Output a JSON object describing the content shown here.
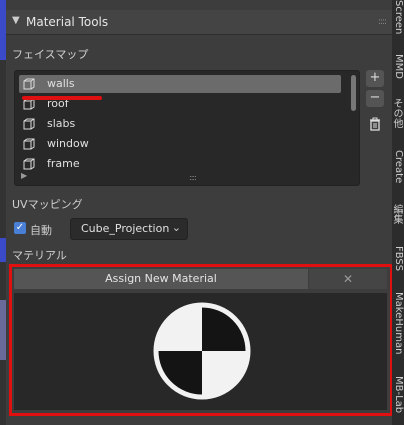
{
  "panel": {
    "title": "Material Tools",
    "face_map_label": "フェイスマップ",
    "face_maps": [
      {
        "name": "walls",
        "selected": true
      },
      {
        "name": "roof",
        "selected": false
      },
      {
        "name": "slabs",
        "selected": false
      },
      {
        "name": "window",
        "selected": false
      },
      {
        "name": "frame",
        "selected": false
      }
    ],
    "add_label": "+",
    "remove_label": "−",
    "uv_mapping_label": "UVマッピング",
    "auto_label": "自動",
    "projection_value": "Cube_Projection",
    "material_label": "マテリアル",
    "assign_label": "Assign New Material",
    "close_label": "✕"
  },
  "tabs": [
    "Screen",
    "MMD",
    "その他",
    "Create",
    "編集",
    "FBSS",
    "MakeHuman",
    "MB-Lab"
  ],
  "colors": {
    "accent_red": "#e01010",
    "checkbox_blue": "#4a7fd6",
    "selected_row": "#6b6b6b"
  }
}
